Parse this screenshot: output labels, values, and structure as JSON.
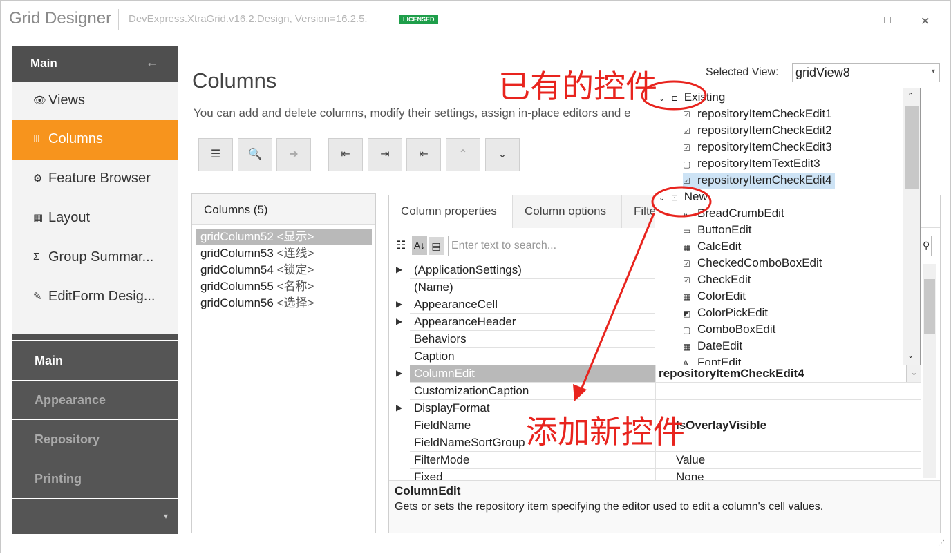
{
  "window": {
    "app_title": "Grid Designer",
    "version": "DevExpress.XtraGrid.v16.2.Design, Version=16.2.5.",
    "licensed": "LICENSED",
    "minimize": "□",
    "close": "✕"
  },
  "sidebar": {
    "header": "Main",
    "back": "←",
    "items": [
      {
        "icon": "👁",
        "label": "Views"
      },
      {
        "icon": "Ⅲ",
        "label": "Columns"
      },
      {
        "icon": "⚙",
        "label": "Feature Browser"
      },
      {
        "icon": "▦",
        "label": "Layout"
      },
      {
        "icon": "Σ",
        "label": "Group Summar..."
      },
      {
        "icon": "✎",
        "label": "EditForm Desig..."
      }
    ],
    "grip": "...",
    "groups": [
      "Main",
      "Appearance",
      "Repository",
      "Printing"
    ],
    "more": "▾"
  },
  "main": {
    "title": "Columns",
    "description": "You can add and delete columns, modify their settings, assign in-place editors and e",
    "selected_view_label": "Selected View:",
    "selected_view": "gridView8",
    "selected_view_arrow": "▾"
  },
  "toolbar": [
    "☰",
    "🔍",
    "➔",
    "⇤",
    "⇥",
    "⇤",
    "⌃",
    "⌄"
  ],
  "columns_panel": {
    "header": "Columns (5)",
    "items": [
      {
        "name": "gridColumn52",
        "caption": "<显示>"
      },
      {
        "name": "gridColumn53",
        "caption": "<连线>"
      },
      {
        "name": "gridColumn54",
        "caption": "<锁定>"
      },
      {
        "name": "gridColumn55",
        "caption": "<名称>"
      },
      {
        "name": "gridColumn56",
        "caption": "<选择>"
      }
    ]
  },
  "properties": {
    "tabs": [
      "Column properties",
      "Column options",
      "Filte"
    ],
    "search_placeholder": "Enter text to search...",
    "rows": [
      {
        "name": "(ApplicationSettings)",
        "value": "",
        "expand": "▶"
      },
      {
        "name": "(Name)",
        "value": "",
        "expand": ""
      },
      {
        "name": "AppearanceCell",
        "value": "",
        "expand": "▶"
      },
      {
        "name": "AppearanceHeader",
        "value": "",
        "expand": "▶"
      },
      {
        "name": "Behaviors",
        "value": "",
        "expand": ""
      },
      {
        "name": "Caption",
        "value": "",
        "expand": ""
      },
      {
        "name": "ColumnEdit",
        "value": "repositoryItemCheckEdit4",
        "expand": "▶"
      },
      {
        "name": "CustomizationCaption",
        "value": "",
        "expand": ""
      },
      {
        "name": "DisplayFormat",
        "value": "",
        "expand": "▶"
      },
      {
        "name": "FieldName",
        "value": "IsOverlayVisible",
        "expand": ""
      },
      {
        "name": "FieldNameSortGroup",
        "value": "",
        "expand": ""
      },
      {
        "name": "FilterMode",
        "value": "Value",
        "expand": ""
      },
      {
        "name": "Fixed",
        "value": "None",
        "expand": ""
      }
    ],
    "desc_title": "ColumnEdit",
    "desc_text": "Gets or sets the repository item specifying the editor used to edit a column's cell values."
  },
  "popup": {
    "existing_label": "Existing",
    "existing": [
      {
        "icon": "☑",
        "label": "repositoryItemCheckEdit1"
      },
      {
        "icon": "☑",
        "label": "repositoryItemCheckEdit2"
      },
      {
        "icon": "☑",
        "label": "repositoryItemCheckEdit3"
      },
      {
        "icon": "▢",
        "label": "repositoryItemTextEdit3"
      },
      {
        "icon": "☑",
        "label": "repositoryItemCheckEdit4"
      }
    ],
    "new_label": "New",
    "new": [
      {
        "icon": "»",
        "label": "BreadCrumbEdit"
      },
      {
        "icon": "▭",
        "label": "ButtonEdit"
      },
      {
        "icon": "▦",
        "label": "CalcEdit"
      },
      {
        "icon": "☑",
        "label": "CheckedComboBoxEdit"
      },
      {
        "icon": "☑",
        "label": "CheckEdit"
      },
      {
        "icon": "▦",
        "label": "ColorEdit"
      },
      {
        "icon": "◩",
        "label": "ColorPickEdit"
      },
      {
        "icon": "▢",
        "label": "ComboBoxEdit"
      },
      {
        "icon": "▦",
        "label": "DateEdit"
      },
      {
        "icon": "A",
        "label": "FontEdit"
      }
    ]
  },
  "annotations": {
    "existing_note": "已有的控件",
    "new_note": "添加新控件"
  },
  "colors": {
    "accent": "#f7941d",
    "sidebar_dark": "#4f4f4f",
    "annotation": "#e8241e"
  }
}
